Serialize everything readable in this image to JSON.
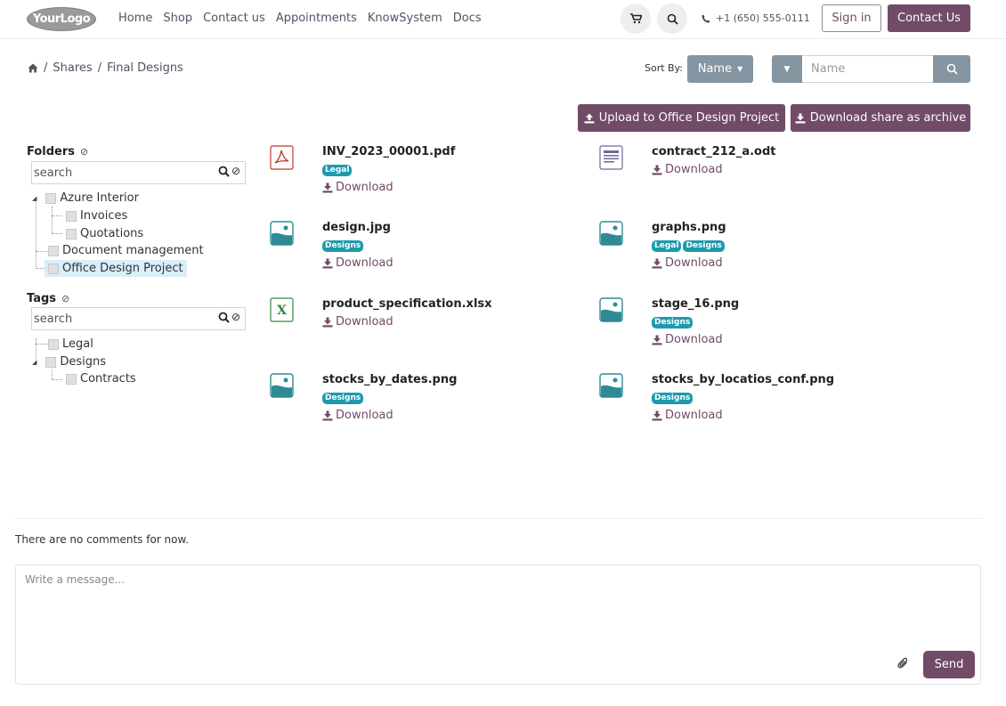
{
  "header": {
    "logo_text": "YourLogo",
    "nav": [
      "Home",
      "Shop",
      "Contact us",
      "Appointments",
      "KnowSystem",
      "Docs"
    ],
    "phone": "+1 (650) 555-0111",
    "sign_in": "Sign in",
    "contact_us": "Contact Us"
  },
  "breadcrumb": {
    "items": [
      "Shares",
      "Final Designs"
    ],
    "sep": "/"
  },
  "sort": {
    "label": "Sort By:",
    "value": "Name",
    "search_placeholder": "Name"
  },
  "actions": {
    "upload": "Upload to Office Design Project",
    "archive": "Download share as archive"
  },
  "folders": {
    "title": "Folders",
    "search": "search",
    "items": [
      "Azure Interior",
      "Invoices",
      "Quotations",
      "Document management",
      "Office Design Project"
    ]
  },
  "tags": {
    "title": "Tags",
    "search": "search",
    "items": [
      "Legal",
      "Designs",
      "Contracts"
    ]
  },
  "files": [
    {
      "name": "INV_2023_00001.pdf",
      "tags": [
        "Legal"
      ],
      "type": "pdf"
    },
    {
      "name": "contract_212_a.odt",
      "tags": [],
      "type": "doc"
    },
    {
      "name": "design.jpg",
      "tags": [
        "Designs"
      ],
      "type": "image"
    },
    {
      "name": "graphs.png",
      "tags": [
        "Legal",
        "Designs"
      ],
      "type": "image"
    },
    {
      "name": "product_specification.xlsx",
      "tags": [],
      "type": "xls"
    },
    {
      "name": "stage_16.png",
      "tags": [
        "Designs"
      ],
      "type": "image"
    },
    {
      "name": "stocks_by_dates.png",
      "tags": [
        "Designs"
      ],
      "type": "image"
    },
    {
      "name": "stocks_by_locatios_conf.png",
      "tags": [
        "Designs"
      ],
      "type": "image"
    }
  ],
  "download_label": "Download",
  "comments": {
    "empty": "There are no comments for now.",
    "placeholder": "Write a message...",
    "send": "Send"
  },
  "colors": {
    "primary": "#714b67",
    "secondary": "#8595a2",
    "tag": "#1f9aad"
  }
}
